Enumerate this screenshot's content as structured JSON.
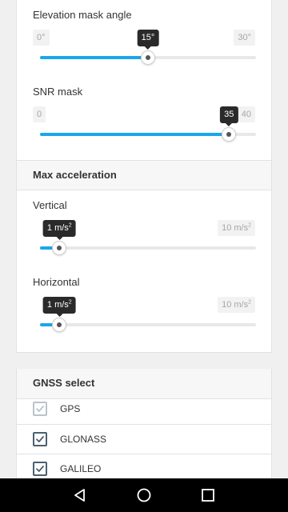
{
  "elevation": {
    "label": "Elevation mask angle",
    "min": "0°",
    "max": "30°",
    "value": "15°",
    "fraction": 0.5
  },
  "snr": {
    "label": "SNR mask",
    "min": "0",
    "max": "40",
    "value": "35",
    "fraction": 0.875
  },
  "max_acceleration": {
    "header": "Max acceleration",
    "vertical": {
      "label": "Vertical",
      "value_text": "1 m/s",
      "max_text": "10 m/s",
      "unit_power": "2",
      "fraction": 0.09
    },
    "horizontal": {
      "label": "Horizontal",
      "value_text": "1 m/s",
      "max_text": "10 m/s",
      "unit_power": "2",
      "fraction": 0.09
    }
  },
  "gnss": {
    "header": "GNSS select",
    "items": [
      {
        "label": "GPS",
        "checked": true,
        "enabled": false
      },
      {
        "label": "GLONASS",
        "checked": true,
        "enabled": true
      },
      {
        "label": "GALILEO",
        "checked": true,
        "enabled": true
      }
    ]
  },
  "colors": {
    "accent": "#1aa7e8",
    "tooltip": "#2a2a2a",
    "checkbox": "#4a6070"
  },
  "nav": {
    "back_icon": "triangle-back",
    "home_icon": "circle-home",
    "recent_icon": "square-recent"
  }
}
